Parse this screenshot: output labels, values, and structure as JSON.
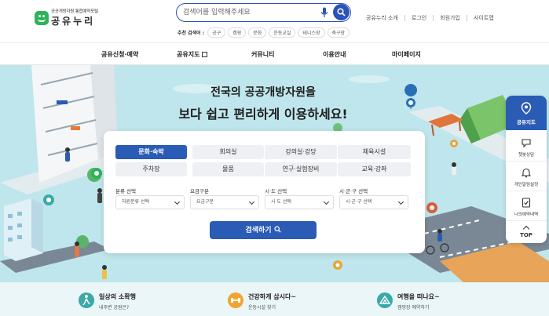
{
  "logo": {
    "sub": "공공개방자원 통합예약포털",
    "main": "공유누리"
  },
  "search": {
    "placeholder": "검색어를 입력해주세요"
  },
  "recommend": {
    "label": "추천 검색어 :",
    "tags": [
      "공구",
      "캠핑",
      "문화",
      "운동교실",
      "테니스장",
      "축구장"
    ]
  },
  "top_links": [
    "공유누리 소개",
    "로그인",
    "회원가입",
    "사이트맵"
  ],
  "gnb": [
    "공유신청·예약",
    "공유지도",
    "커뮤니티",
    "이용안내",
    "마이페이지"
  ],
  "hero": {
    "line1": "전국의 공공개방자원을",
    "line2": "보다 쉽고 편리하게 이용하세요!"
  },
  "categories": [
    [
      "문화·숙박",
      "회의실",
      "강의실·강당",
      "체육시설"
    ],
    [
      "주차장",
      "물품",
      "연구·실험장비",
      "교육·강좌"
    ]
  ],
  "filters": [
    {
      "label": "분류 선택",
      "value": "자원분류 선택"
    },
    {
      "label": "요금구분",
      "value": "요금구분"
    },
    {
      "label": "시·도 선택",
      "value": "시·도 선택"
    },
    {
      "label": "시·군·구 선택",
      "value": "시·군·구 선택"
    }
  ],
  "submit_label": "검색하기",
  "quick": {
    "top": "공유지도",
    "items": [
      "챗봇상담",
      "개인알림설정",
      "나의예약내역"
    ],
    "top_btn": "TOP"
  },
  "bottom": [
    {
      "title": "일상의 소확행",
      "sub": "내주변 공원은?",
      "icon_color": "#3aa9a8"
    },
    {
      "title": "건강하게 삽시다~",
      "sub": "운동시설 찾기",
      "icon_color": "#f0a531"
    },
    {
      "title": "여행을 떠나요~",
      "sub": "캠핑장 예약하기",
      "icon_color": "#3aa9a8"
    }
  ],
  "colors": {
    "primary": "#2a5bb5",
    "logo": "#2eb35a",
    "hero_bg": "#bfe6ec"
  }
}
